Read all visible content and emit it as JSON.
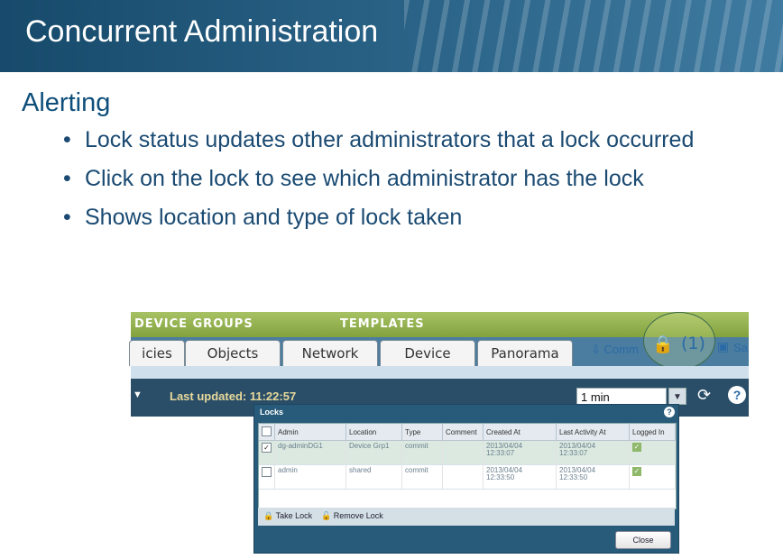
{
  "slide": {
    "title": "Concurrent Administration",
    "section": "Alerting",
    "bullets": [
      "Lock status updates other administrators that a lock occurred",
      "Click on the lock to see which administrator has the lock",
      "Shows location and type of lock taken"
    ]
  },
  "app": {
    "top_groups": [
      "DEVICE GROUPS",
      "TEMPLATES"
    ],
    "tabs": [
      "icies",
      "Objects",
      "Network",
      "Device",
      "Panorama"
    ],
    "commit_label": "Comm",
    "lock_count": "(1)",
    "save_label": "Sa",
    "last_updated_label": "Last updated:",
    "last_updated_time": "11:22:57",
    "refresh_interval": "1 min"
  },
  "locks_dialog": {
    "title": "Locks",
    "columns": [
      "Admin",
      "Location",
      "Type",
      "Comment",
      "Created At",
      "Last Activity At",
      "Logged In"
    ],
    "rows": [
      {
        "checked": true,
        "admin": "dg-adminDG1",
        "location": "Device Grp1",
        "type": "commit",
        "comment": "",
        "created_date": "2013/04/04",
        "created_time": "12:33:07",
        "activity_date": "2013/04/04",
        "activity_time": "12:33:07",
        "logged_in": true
      },
      {
        "checked": false,
        "admin": "admin",
        "location": "shared",
        "type": "commit",
        "comment": "",
        "created_date": "2013/04/04",
        "created_time": "12:33:50",
        "activity_date": "2013/04/04",
        "activity_time": "12:33:50",
        "logged_in": true
      }
    ],
    "take_lock": "Take Lock",
    "remove_lock": "Remove Lock",
    "close": "Close"
  },
  "colors": {
    "banner": "#1f5578",
    "text_blue": "#1a4a72",
    "toolbar": "#2a4e68",
    "green_band": "#8fae4a"
  }
}
